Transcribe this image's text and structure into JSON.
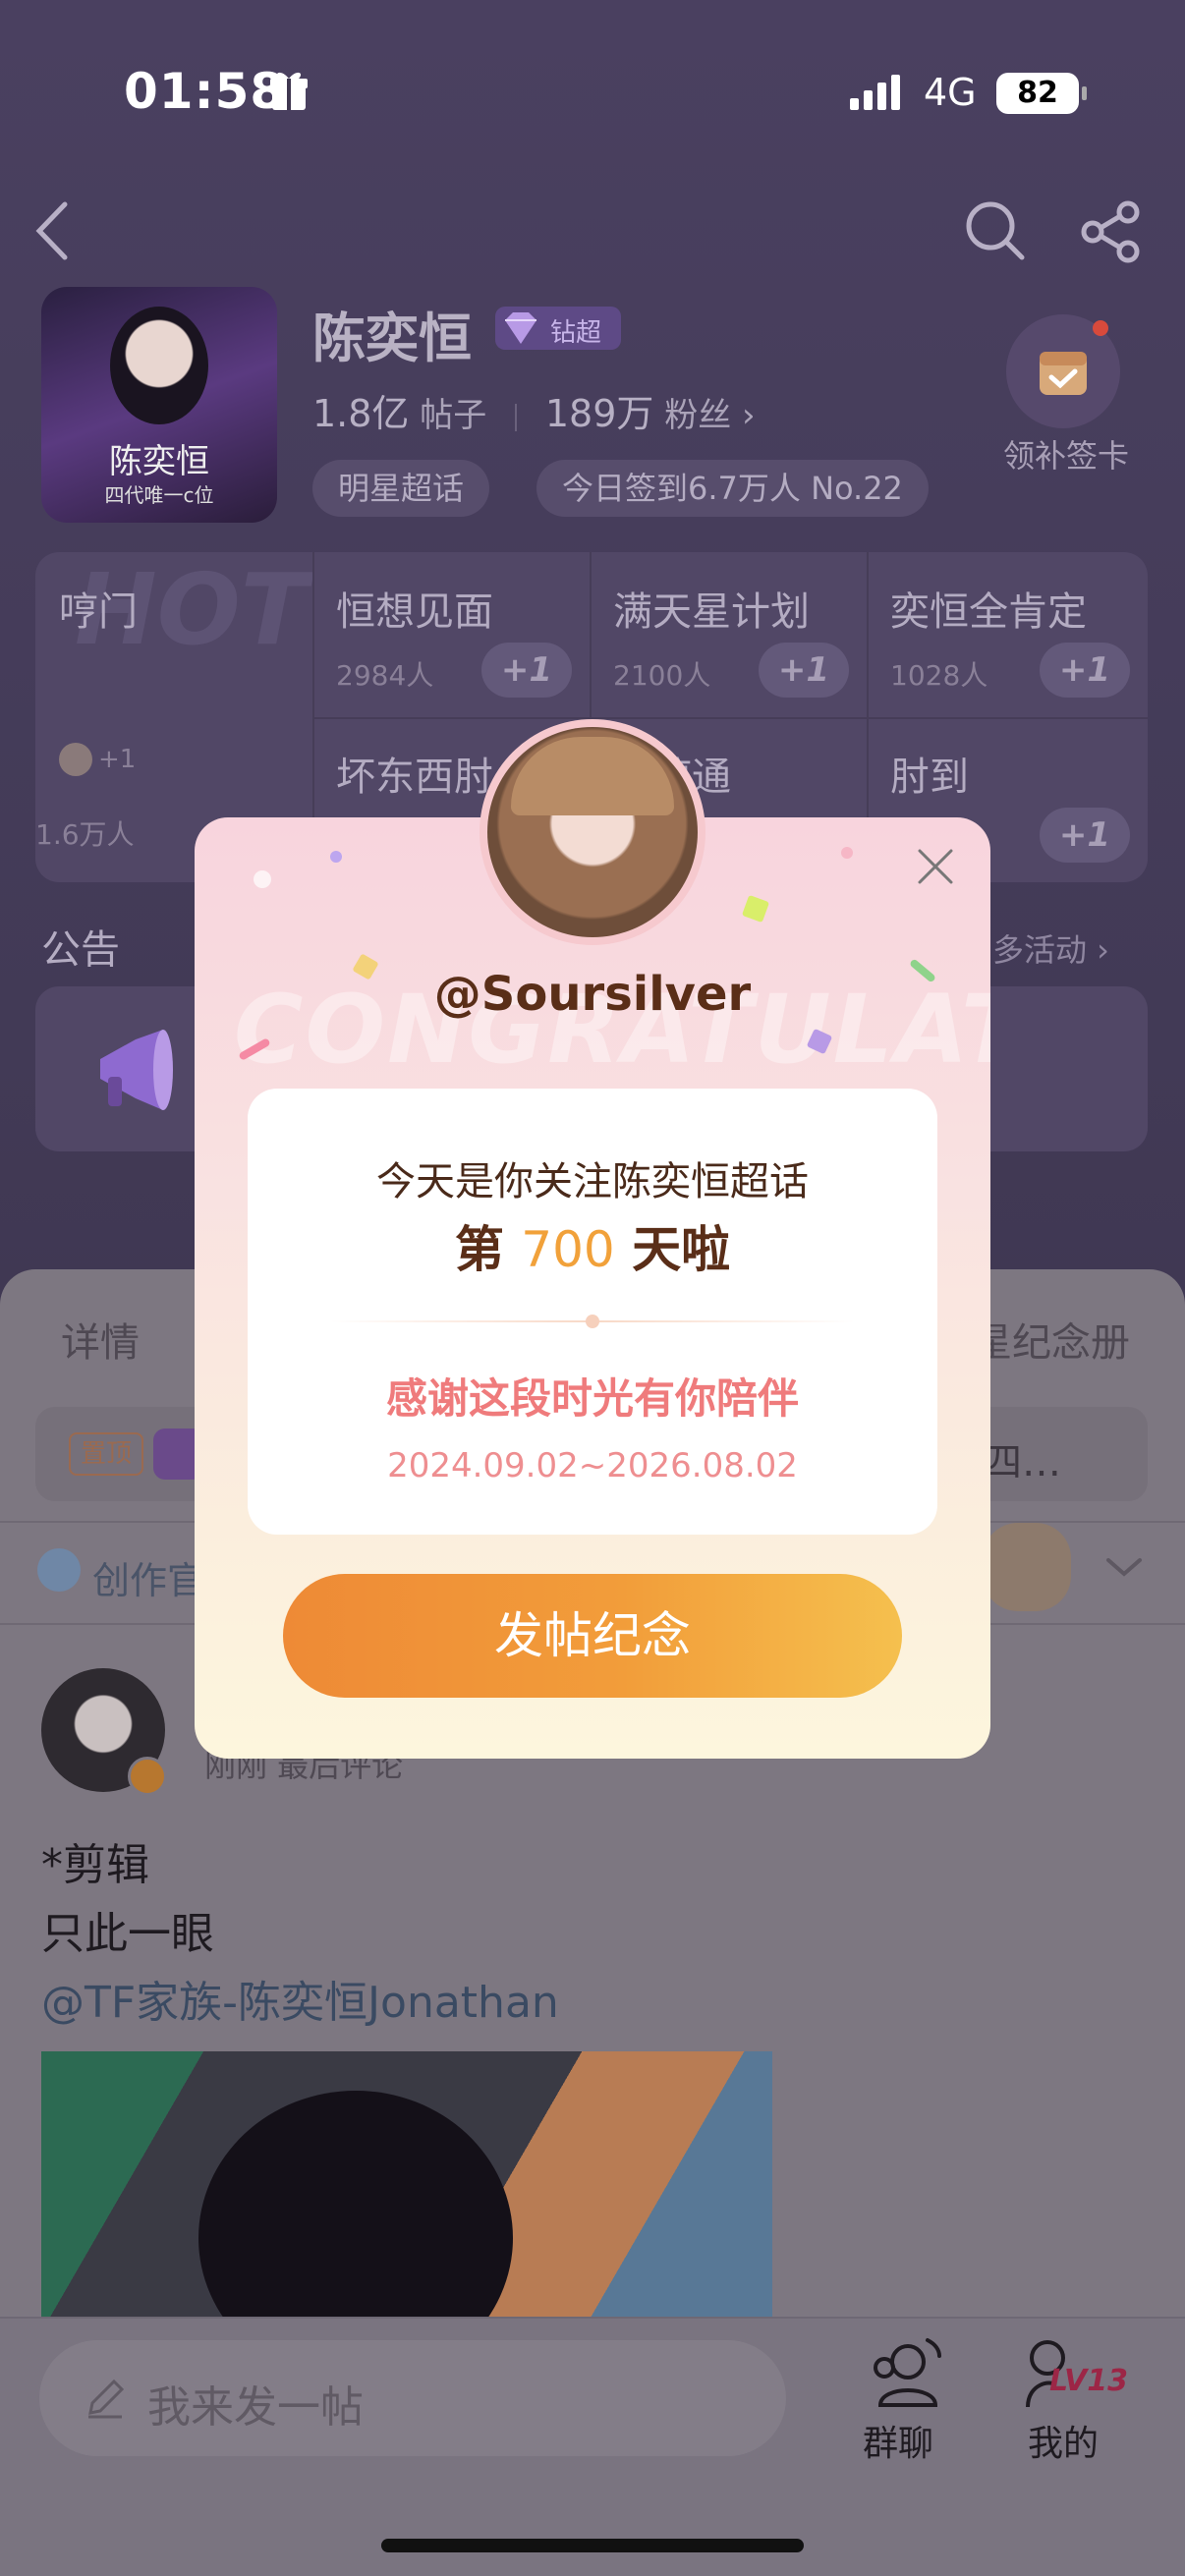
{
  "status_bar": {
    "time": "01:58",
    "network": "4G",
    "battery": "82"
  },
  "profile": {
    "name": "陈奕恒",
    "badge": "钻超",
    "posts_count": "1.8亿",
    "posts_label": "帖子",
    "fans_count": "189万",
    "fans_label": "粉丝",
    "fans_arrow": "›",
    "tags": [
      "明星超话",
      "今日签到6.7万人 No.22"
    ],
    "checkin_label": "领补签卡",
    "cover_name": "陈奕恒",
    "cover_sub": "四代唯一c位"
  },
  "activities": {
    "hot_word": "HOT",
    "first": {
      "title": "哼门",
      "count": "1.6万人",
      "plus": "+1"
    },
    "cells": [
      {
        "title": "恒想见面",
        "count": "2984人",
        "plus": "+1"
      },
      {
        "title": "满天星计划",
        "count": "2100人",
        "plus": "+1"
      },
      {
        "title": "奕恒全肯定",
        "count": "1028人",
        "plus": "+1"
      },
      {
        "title": "坏东西肘",
        "count": "",
        "plus": ""
      },
      {
        "title": "哼哼通",
        "count": "",
        "plus": ""
      },
      {
        "title": "肘到",
        "count": "",
        "plus": "+1"
      }
    ]
  },
  "notice": {
    "title": "公告",
    "more": "多活动 ›"
  },
  "sheet": {
    "tab_detail": "详情",
    "tab_album": "星纪念册",
    "pin_tag": "置顶",
    "pin_tail": "四…",
    "creator": "创作官"
  },
  "post": {
    "meta": "刚刚 最后评论",
    "lines": [
      "*剪辑",
      "只此一眼"
    ],
    "mention": "@TF家族-陈奕恒Jonathan"
  },
  "bottom_bar": {
    "compose_placeholder": "我来发一帖",
    "group_label": "群聊",
    "me_label": "我的",
    "level": "LV13"
  },
  "modal": {
    "bg_word": "CONGRATULATE",
    "handle": "@Soursilver",
    "line1": "今天是你关注陈奕恒超话",
    "line2_prefix": "第",
    "line2_days": "700",
    "line2_suffix": "天啦",
    "line3": "感谢这段时光有你陪伴",
    "date_range": "2024.09.02~2026.08.02",
    "cta": "发帖纪念"
  },
  "colors": {
    "accent_orange": "#f29d3a",
    "days_color": "#f1a13a",
    "thanks_pink": "#ef7b7c",
    "modal_title_brown": "#5a2e18"
  }
}
